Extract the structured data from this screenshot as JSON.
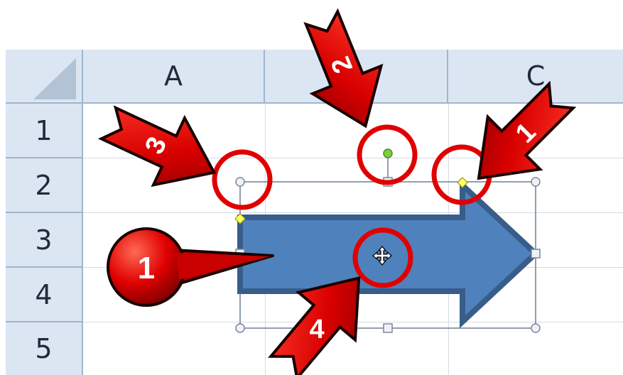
{
  "spreadsheet": {
    "columns": [
      "A",
      "",
      "C"
    ],
    "rows": [
      "1",
      "2",
      "3",
      "4",
      "5"
    ]
  },
  "callouts": {
    "bubble_label": "1",
    "arrow_labels": [
      "1",
      "2",
      "3",
      "4"
    ]
  },
  "colors": {
    "header_bg": "#dce6f2",
    "header_border": "#9eb6ce",
    "shape_fill": "#4f81bd",
    "shape_stroke": "#385d8a",
    "callout_red": "#e00000",
    "rotation_handle": "#7fcf3f",
    "adjust_handle": "#ffff66"
  }
}
